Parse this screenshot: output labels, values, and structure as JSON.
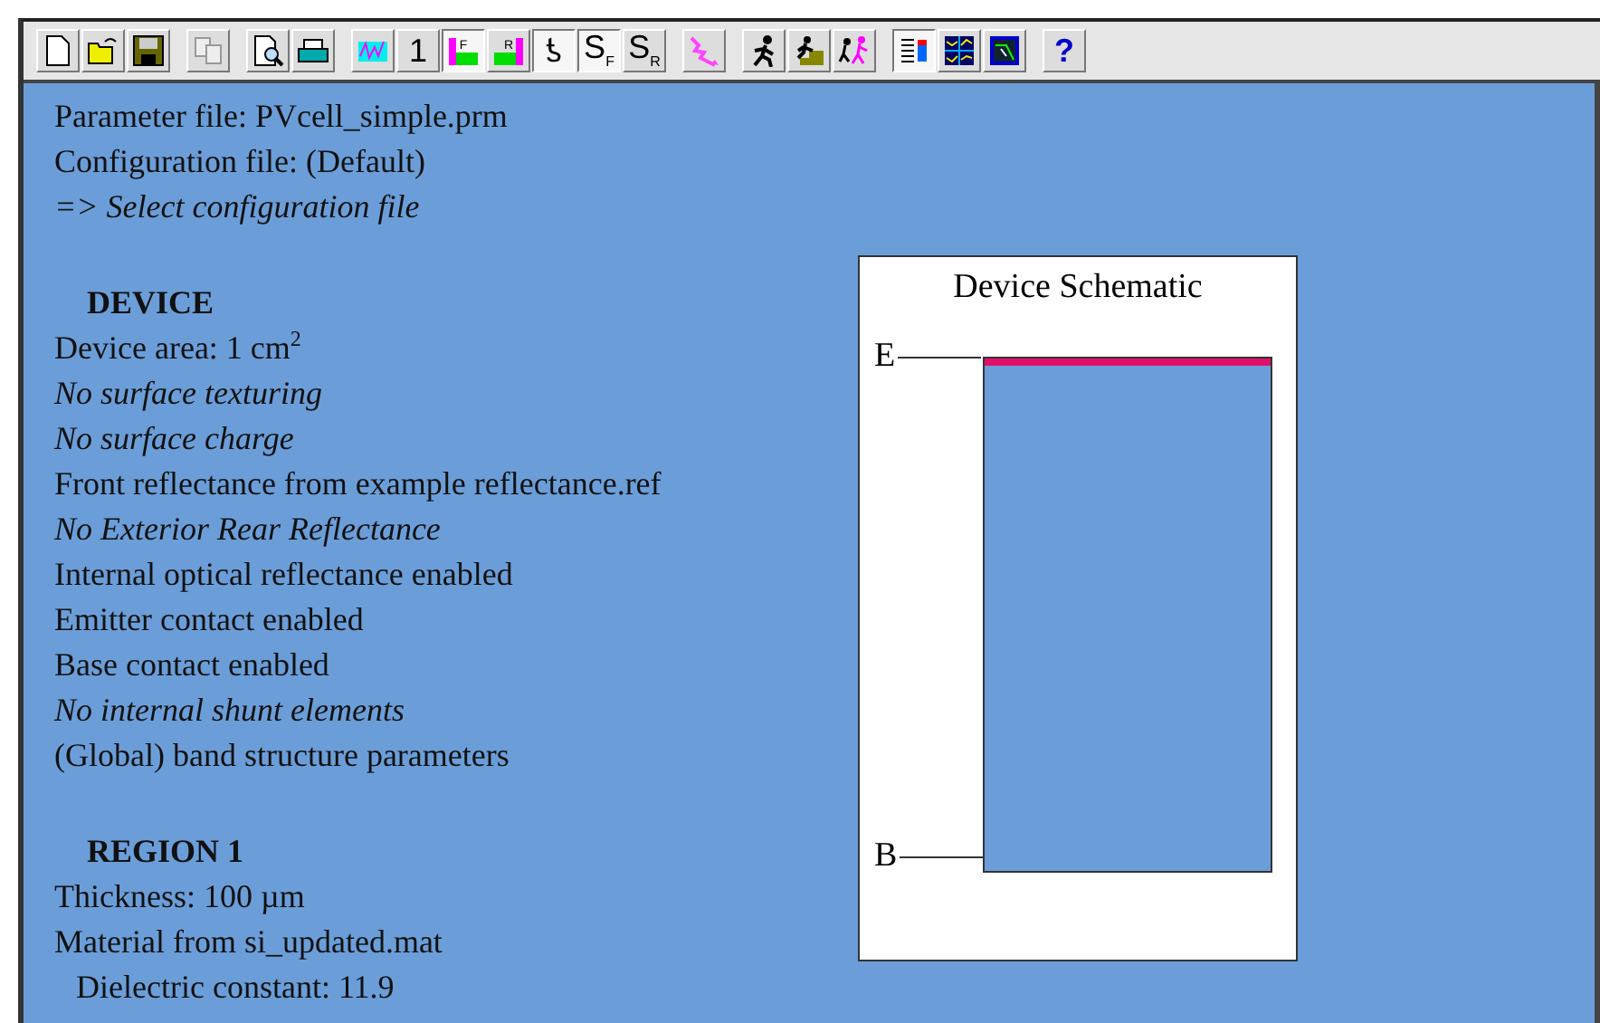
{
  "toolbar": [
    [
      {
        "kind": "new",
        "on": false
      },
      {
        "kind": "open",
        "on": false
      },
      {
        "kind": "save",
        "on": false
      }
    ],
    [
      {
        "kind": "copy",
        "on": false
      }
    ],
    [
      {
        "kind": "preview",
        "on": false
      },
      {
        "kind": "print",
        "on": false
      }
    ],
    [
      {
        "kind": "spectrum",
        "on": false
      },
      {
        "kind": "text",
        "label": "1",
        "on": false
      },
      {
        "kind": "front",
        "label": "F",
        "on": true
      },
      {
        "kind": "rear",
        "label": "R",
        "on": false
      },
      {
        "kind": "text",
        "label": "ƾ",
        "on": true
      },
      {
        "kind": "text",
        "label": "S$_{F}$",
        "on": true
      },
      {
        "kind": "text",
        "label": "S$_{R}$",
        "on": false
      }
    ],
    [
      {
        "kind": "light",
        "on": false
      }
    ],
    [
      {
        "kind": "run",
        "on": false
      },
      {
        "kind": "run-steps",
        "on": false
      },
      {
        "kind": "run-batch",
        "on": false
      }
    ],
    [
      {
        "kind": "report",
        "on": true
      },
      {
        "kind": "graphs",
        "on": false
      },
      {
        "kind": "device",
        "on": false
      }
    ],
    [
      {
        "kind": "help",
        "label": "?",
        "on": false
      }
    ]
  ],
  "header": [
    {
      "text": "Parameter file: PVcell_simple.prm",
      "kind": "plain"
    },
    {
      "text": "Configuration file: (Default)",
      "kind": "plain"
    },
    {
      "text": "=> Select configuration file",
      "kind": "italic"
    }
  ],
  "sections": [
    {
      "heading": "DEVICE",
      "lines": [
        {
          "text": "Device area: 1 cm$^{2}$",
          "kind": "plain"
        },
        {
          "text": "No surface texturing",
          "kind": "italic"
        },
        {
          "text": "No surface charge",
          "kind": "italic"
        },
        {
          "text": "Front reflectance from example reflectance.ref",
          "kind": "plain"
        },
        {
          "text": "No Exterior Rear Reflectance",
          "kind": "italic"
        },
        {
          "text": "Internal optical reflectance enabled",
          "kind": "plain"
        },
        {
          "text": "Emitter contact enabled",
          "kind": "plain"
        },
        {
          "text": "Base contact enabled",
          "kind": "plain"
        },
        {
          "text": "No internal shunt elements",
          "kind": "italic"
        },
        {
          "text": "(Global) band structure parameters",
          "kind": "plain"
        }
      ]
    },
    {
      "heading": "REGION 1",
      "lines": [
        {
          "text": "Thickness: 100 µm",
          "kind": "plain"
        },
        {
          "text": "Material from si_updated.mat",
          "kind": "plain"
        },
        {
          "text": "Dielectric constant: 11.9",
          "kind": "sub"
        }
      ]
    }
  ],
  "schematic": {
    "title": "Device Schematic",
    "top_contact": "E",
    "bottom_contact": "B"
  }
}
